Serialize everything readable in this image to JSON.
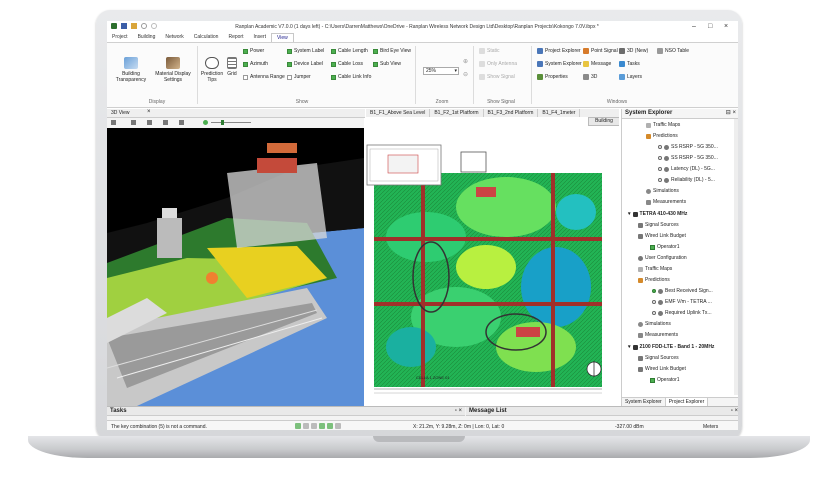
{
  "window": {
    "title": "Ranplan Academic V7.0.0 (1 days left) - C:\\Users\\DarrenMatthews\\OneDrive - Ranplan Wireless Network Design Ltd\\Desktop\\Ranplan Projects\\Kokongo 7.0V.ibpx *"
  },
  "ribbon_tabs": [
    "Project",
    "Building",
    "Network",
    "Calculation",
    "Report",
    "Insert",
    "View"
  ],
  "ribbon": {
    "display": {
      "building_transparency": "Building Transparency",
      "material_display": "Material Display Settings",
      "group_label": "Display"
    },
    "show": {
      "prediction_tips": "Prediction Tips",
      "grid": "Grid",
      "power": "Power",
      "azimuth": "Azimuth",
      "antenna_range": "Antenna Range",
      "system_label": "System Label",
      "device_label": "Device Label",
      "jumper": "Jumper",
      "cable_length": "Cable Length",
      "cable_loss": "Cable Loss",
      "cable_link_info": "Cable Link Info",
      "bird_eye_view": "Bird Eye View",
      "sub_view": "Sub View",
      "group_label": "Show"
    },
    "zoom": {
      "value": "25%",
      "group_label": "Zoom"
    },
    "show_signal": {
      "static": "Static",
      "only_antenna": "Only Antenna",
      "show_signal": "Show Signal",
      "group_label": "Show Signal"
    },
    "windows": {
      "project_explorer": "Project Explorer",
      "system_explorer": "System Explorer",
      "properties": "Properties",
      "point_signal": "Point Signal",
      "message": "Message",
      "three_d": "3D",
      "three_d_new": "3D (New)",
      "tasks": "Tasks",
      "layers": "Layers",
      "nso_table": "NSO Table",
      "group_label": "Windows"
    }
  },
  "view3d": {
    "tab_label": "3D View"
  },
  "plan_tabs": [
    "B1_F1_Above Sea Level",
    "B1_F2_1st Platform",
    "B1_F3_2nd Platform",
    "B1_F4_1meter"
  ],
  "plan": {
    "building_label": "Building",
    "room_label": "CELLA 1 ZONE 01"
  },
  "explorer": {
    "title": "System Explorer",
    "items": [
      {
        "label": "Traffic Maps"
      },
      {
        "label": "Predictions"
      },
      {
        "label": "SS RSRP - 5G 350..."
      },
      {
        "label": "SS RSRP - 5G 350..."
      },
      {
        "label": "Latency (DL) - 5G..."
      },
      {
        "label": "Reliability (DL) - 5..."
      },
      {
        "label": "Simulations"
      },
      {
        "label": "Measurements"
      },
      {
        "label": "TETRA 410-430 MHz"
      },
      {
        "label": "Signal Sources"
      },
      {
        "label": "Wired Link Budget"
      },
      {
        "label": "Operator1"
      },
      {
        "label": "User Configuration"
      },
      {
        "label": "Traffic Maps"
      },
      {
        "label": "Predictions"
      },
      {
        "label": "Best Received Sign..."
      },
      {
        "label": "EMF V/m - TETRA ..."
      },
      {
        "label": "Required Uplink Tx..."
      },
      {
        "label": "Simulations"
      },
      {
        "label": "Measurements"
      },
      {
        "label": "2100 FDD-LTE - Band 1 - 20MHz"
      },
      {
        "label": "Signal Sources"
      },
      {
        "label": "Wired Link Budget"
      },
      {
        "label": "Operator1"
      }
    ],
    "tabs": [
      "System Explorer",
      "Project Explorer"
    ]
  },
  "bottom": {
    "tasks_title": "Tasks",
    "messages_title": "Message List"
  },
  "status": {
    "message": "The key combination (5) is not a command.",
    "coords": "X: 21.2m, Y: 9.28m, Z: 0m | Lon: 0, Lat: 0",
    "signal": "-327.00 dBm",
    "units": "Meters"
  }
}
